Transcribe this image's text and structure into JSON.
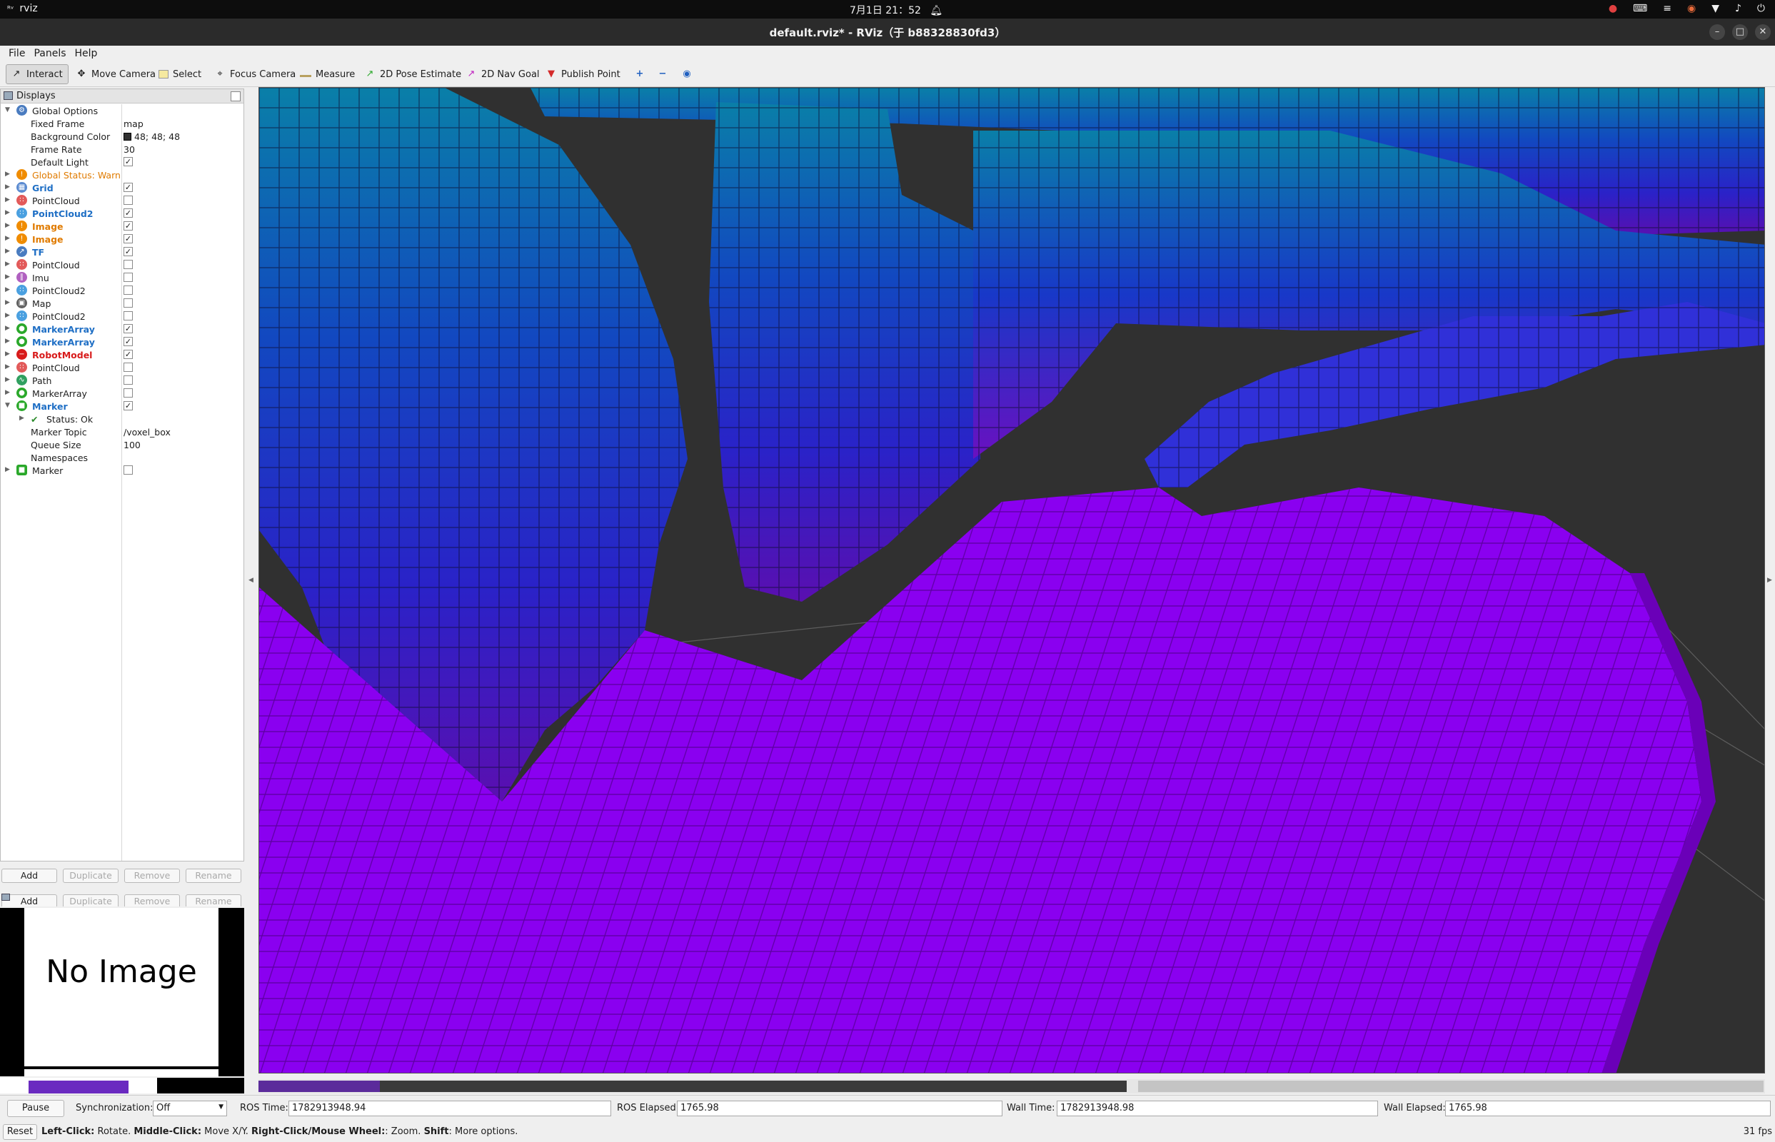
{
  "topbar": {
    "app_name": "rviz",
    "clock": "7月1日  21：52",
    "bell_icon": "bell-icon",
    "tray_icons": [
      "record-icon",
      "keyboard-icon",
      "network-icon",
      "app-icon",
      "wifi-icon",
      "volume-icon",
      "power-icon"
    ]
  },
  "window": {
    "title": "default.rviz* - RViz（于 b88328830fd3）"
  },
  "menubar": {
    "file": "File",
    "panels": "Panels",
    "help": "Help"
  },
  "toolbar": {
    "interact": "Interact",
    "move_camera": "Move Camera",
    "select": "Select",
    "focus_camera": "Focus Camera",
    "measure": "Measure",
    "pose_estimate": "2D Pose Estimate",
    "nav_goal": "2D Nav Goal",
    "publish_point": "Publish Point"
  },
  "displays": {
    "title": "Displays",
    "global_options": "Global Options",
    "fixed_frame_label": "Fixed Frame",
    "fixed_frame_value": "map",
    "bg_color_label": "Background Color",
    "bg_color_value": "48; 48; 48",
    "frame_rate_label": "Frame Rate",
    "frame_rate_value": "30",
    "default_light_label": "Default Light",
    "global_status": "Global Status: Warn",
    "items": [
      {
        "label": "Grid",
        "checked": true
      },
      {
        "label": "PointCloud",
        "checked": false
      },
      {
        "label": "PointCloud2",
        "checked": true
      },
      {
        "label": "Image",
        "checked": true
      },
      {
        "label": "Image",
        "checked": true
      },
      {
        "label": "TF",
        "checked": true
      },
      {
        "label": "PointCloud",
        "checked": false
      },
      {
        "label": "Imu",
        "checked": false
      },
      {
        "label": "PointCloud2",
        "checked": false
      },
      {
        "label": "Map",
        "checked": false
      },
      {
        "label": "PointCloud2",
        "checked": false
      },
      {
        "label": "MarkerArray",
        "checked": true
      },
      {
        "label": "MarkerArray",
        "checked": true
      },
      {
        "label": "RobotModel",
        "checked": true
      },
      {
        "label": "PointCloud",
        "checked": false
      },
      {
        "label": "Path",
        "checked": false
      },
      {
        "label": "MarkerArray",
        "checked": false
      },
      {
        "label": "Marker",
        "checked": true
      }
    ],
    "marker_status": "Status: Ok",
    "marker_topic_label": "Marker Topic",
    "marker_topic_value": "/voxel_box",
    "queue_size_label": "Queue Size",
    "queue_size_value": "100",
    "namespaces_label": "Namespaces",
    "last_marker": "Marker",
    "buttons": {
      "add": "Add",
      "duplicate": "Duplicate",
      "remove": "Remove",
      "rename": "Rename"
    }
  },
  "image_panel": {
    "text": "No Image"
  },
  "timebar": {
    "pause": "Pause",
    "sync_label": "Synchronization:",
    "sync_value": "Off",
    "ros_time_label": "ROS Time:",
    "ros_time_value": "1782913948.94",
    "ros_elapsed_label": "ROS Elapsed:",
    "ros_elapsed_value": "1765.98",
    "wall_time_label": "Wall Time:",
    "wall_time_value": "1782913948.98",
    "wall_elapsed_label": "Wall Elapsed:",
    "wall_elapsed_value": "1765.98"
  },
  "statusbar": {
    "reset": "Reset",
    "hint_left_click": "Left-Click:",
    "hint_left_action": " Rotate. ",
    "hint_middle_click": "Middle-Click:",
    "hint_middle_action": " Move X/Y. ",
    "hint_right_click": "Right-Click/Mouse Wheel:",
    "hint_right_action": ": Zoom. ",
    "hint_shift": "Shift",
    "hint_shift_action": ": More options.",
    "fps": "31 fps"
  },
  "colors": {
    "floor": "#8a00f0",
    "wall_top": "#0a78a8",
    "wall_mid": "#1f2cc8",
    "wall_bottom": "#5a10b8",
    "background": "#303030"
  }
}
